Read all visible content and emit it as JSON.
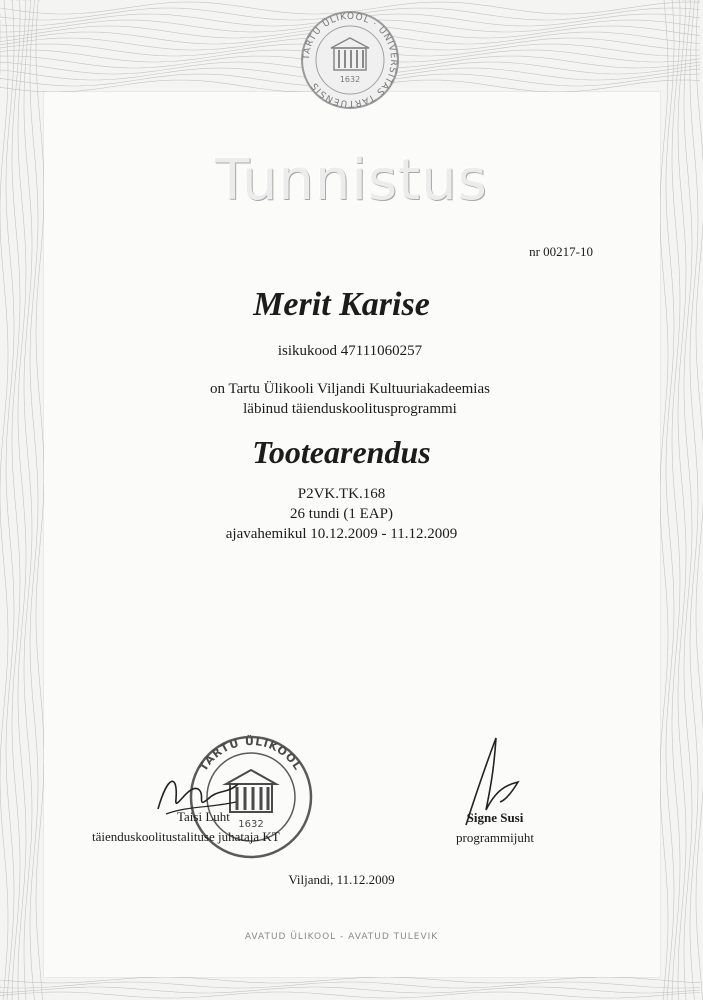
{
  "header": {
    "seal_text": "TARTU ÜLIKOOL · UNIVERSITAS TARTUENSIS",
    "seal_year": "1632",
    "title": "Tunnistus",
    "cert_number": "nr 00217-10"
  },
  "recipient": {
    "name": "Merit Karise",
    "id_line": "isikukood 47111060257"
  },
  "statement": {
    "line1": "on Tartu Ülikooli Viljandi Kultuuriakadeemias",
    "line2": "läbinud täienduskoolitusprogrammi"
  },
  "course": {
    "title": "Tootearendus",
    "code": "P2VK.TK.168",
    "hours": "26 tundi (1 EAP)",
    "period": "ajavahemikul 10.12.2009 - 11.12.2009"
  },
  "signatures": {
    "left_name": "Taisi Luht",
    "left_role": "täienduskoolitustalituse juhataja KT",
    "right_name": "Signe Susi",
    "right_role": "programmijuht"
  },
  "stamp": {
    "text": "TARTU ÜLIKOOL",
    "year": "1632"
  },
  "footer": {
    "place_date": "Viljandi, 11.12.2009",
    "motto": "AVATUD ÜLIKOOL - AVATUD TULEVIK"
  },
  "colors": {
    "paper": "#f4f4f2",
    "panel": "#fbfbfa",
    "guilloche": "#c4c4c4",
    "ink": "#1c1c1c",
    "stamp": "#555555"
  }
}
